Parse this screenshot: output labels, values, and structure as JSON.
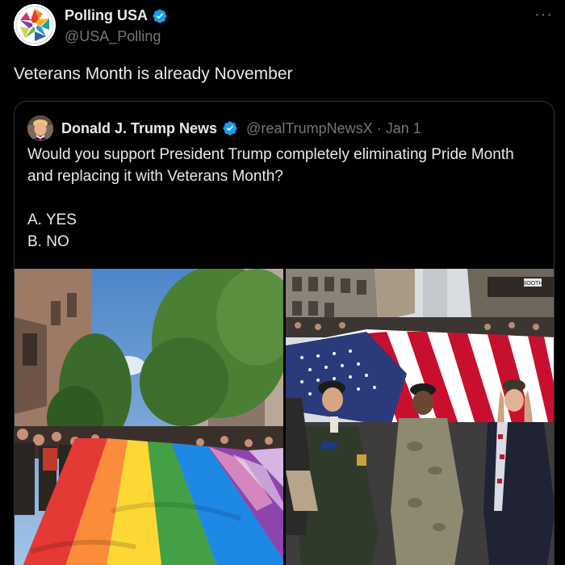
{
  "post": {
    "author_name": "Polling USA",
    "author_handle": "@USA_Polling",
    "text": "Veterans Month is already November",
    "more_label": "···"
  },
  "quoted": {
    "author_name": "Donald J. Trump News",
    "author_handle": "@realTrumpNewsX",
    "separator": "·",
    "date": "Jan 1",
    "question": "Would you support President Trump completely eliminating Pride Month and replacing it with Veterans Month?",
    "option_a": "A. YES",
    "option_b": "B. NO"
  },
  "media": {
    "left_image": "pride-parade-rainbow-flag-photo",
    "right_image": "veterans-parade-american-flag-photo",
    "sign_text": "BOOTH"
  },
  "colors": {
    "background": "#000000",
    "text": "#e7e9ea",
    "muted": "#71767b",
    "border": "#2f3336",
    "verified": "#1d9bf0"
  }
}
